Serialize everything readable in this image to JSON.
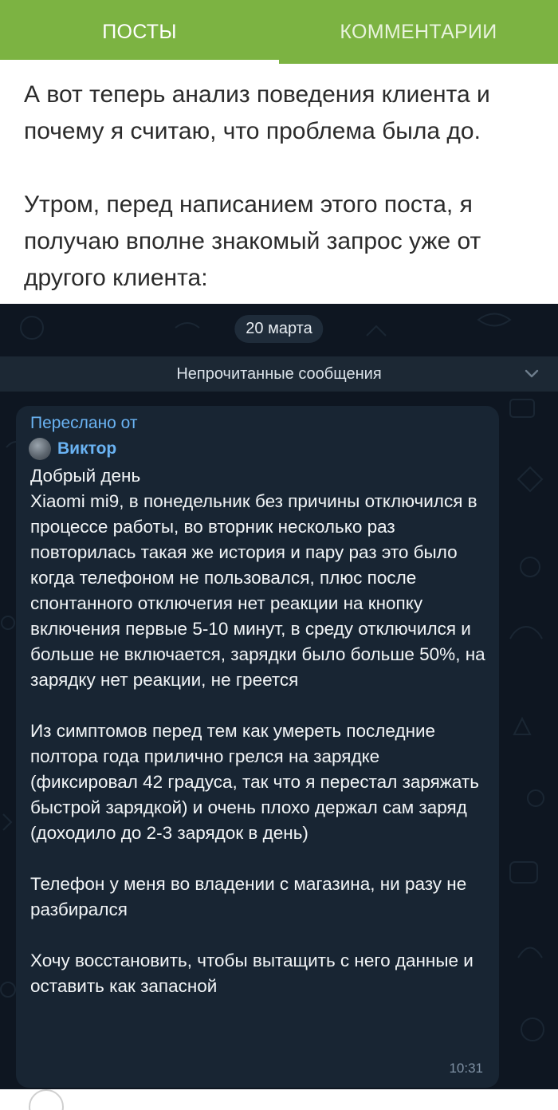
{
  "tabs": [
    {
      "label": "ПОСТЫ",
      "active": true
    },
    {
      "label": "КОММЕНТАРИИ",
      "active": false
    }
  ],
  "post": {
    "paragraphs": [
      "А вот теперь анализ поведения клиента и почему я считаю, что проблема была до.",
      "Утром, перед написанием этого поста, я получаю вполне знакомый запрос уже от другого клиента:"
    ]
  },
  "chat": {
    "date": "20 марта",
    "unread_label": "Непрочитанные сообщения",
    "message": {
      "forwarded_label": "Переслано от",
      "sender": "Виктор",
      "text": "Добрый день\nXiaomi mi9, в понедельник без причины отключился в процессе работы, во вторник несколько раз повторилась такая же история и пару раз это было когда телефоном не пользовался, плюс после спонтанного отключегия нет реакции на кнопку включения первые 5-10 минут, в среду отключился и больше не включается, зарядки было больше 50%, на зарядку нет реакции, не греется\n\nИз симптомов перед тем как умереть последние полтора года прилично грелся на зарядке (фиксировал 42 градуса, так что я перестал заряжать быстрой зарядкой) и очень плохо держал сам заряд (доходило до 2-3 зарядок в день)\n\nТелефон у меня во владении с магазина, ни разу не разбирался\n\nХочу восстановить, чтобы вытащить с него данные и оставить как запасной",
      "time": "10:31"
    }
  },
  "colors": {
    "tab_bar": "#7cb342",
    "chat_bg": "#0e1621",
    "bubble_bg": "#182533",
    "accent_link": "#6ab3f3"
  }
}
